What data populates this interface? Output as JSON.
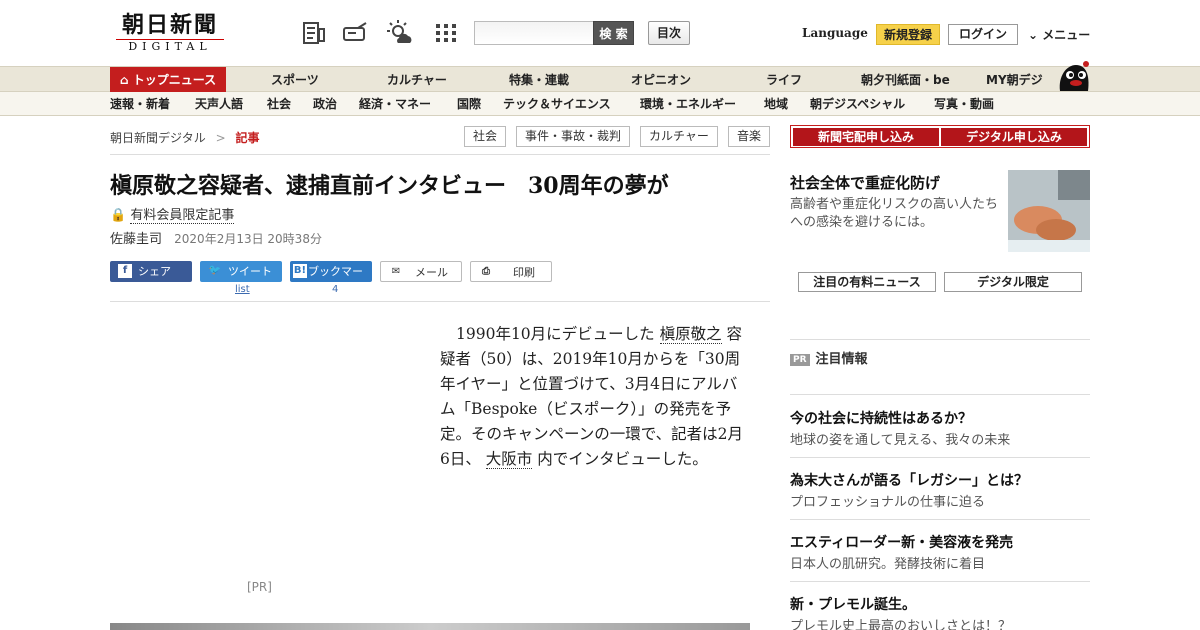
{
  "header": {
    "logo_main": "朝日新聞",
    "logo_sub": "DIGITAL",
    "search_button": "検 索",
    "search_placeholder": "",
    "toc_button": "目次",
    "language": "Language",
    "register": "新規登録",
    "login": "ログイン",
    "menu": "メニュー"
  },
  "main_nav": [
    "トップニュース",
    "スポーツ",
    "カルチャー",
    "特集・連載",
    "オピニオン",
    "ライフ",
    "朝夕刊紙面・be",
    "MY朝デジ"
  ],
  "sub_nav": [
    "速報・新着",
    "天声人語",
    "社会",
    "政治",
    "経済・マネー",
    "国際",
    "テック＆サイエンス",
    "環境・エネルギー",
    "地域",
    "朝デジスペシャル",
    "写真・動画"
  ],
  "breadcrumb": {
    "home": "朝日新聞デジタル",
    "sep": ">",
    "current": "記事"
  },
  "tags": [
    "社会",
    "事件・事故・裁判",
    "カルチャー",
    "音楽"
  ],
  "article": {
    "headline": "槇原敬之容疑者、逮捕直前インタビュー　30周年の夢が",
    "paid_label": "有料会員限定記事",
    "author": "佐藤圭司",
    "date": "2020年2月13日 20時38分",
    "body_before_link1": "1990年10月にデビューした ",
    "body_link1": "槇原敬之",
    "body_after_link1": " 容疑者（50）は、2019年10月からを「30周年イヤー」と位置づけて、3月4日にアルバム「Bespoke（ビスポーク）」の発売を予定。そのキャンペーンの一環で、記者は2月6日、 ",
    "body_link2": "大阪市",
    "body_after_link2": " 内でインタビューした。",
    "pr_label": "[PR]"
  },
  "share": {
    "facebook": "シェア",
    "twitter": "ツイート",
    "twitter_count": "list",
    "hatena": "ブックマーク",
    "hatena_count": "4",
    "mail": "メール",
    "print": "印刷"
  },
  "sidebar": {
    "subscribe_paper": "新聞宅配申し込み",
    "subscribe_digital": "デジタル申し込み",
    "promo_title": "社会全体で重症化防げ",
    "promo_desc": "高齢者や重症化リスクの高い人たちへの感染を避けるには。",
    "tab_paid": "注目の有料ニュース",
    "tab_digital": "デジタル限定",
    "pr_badge": "PR",
    "pr_heading": "注目情報",
    "pr_items": [
      {
        "title": "今の社会に持続性はあるか？",
        "desc": "地球の姿を通して見える、我々の未来"
      },
      {
        "title": "為末大さんが語る「レガシー」とは？",
        "desc": "プロフェッショナルの仕事に迫る"
      },
      {
        "title": "エスティローダー新・美容液を発売",
        "desc": "日本人の肌研究。発酵技術に着目"
      },
      {
        "title": "新・プレモル誕生。",
        "desc": "プレモル史上最高のおいしさとは！？"
      }
    ]
  },
  "colors": {
    "accent_red": "#c41e1e",
    "nav_bg": "#eae6d8",
    "register_yellow": "#f6d14a"
  }
}
